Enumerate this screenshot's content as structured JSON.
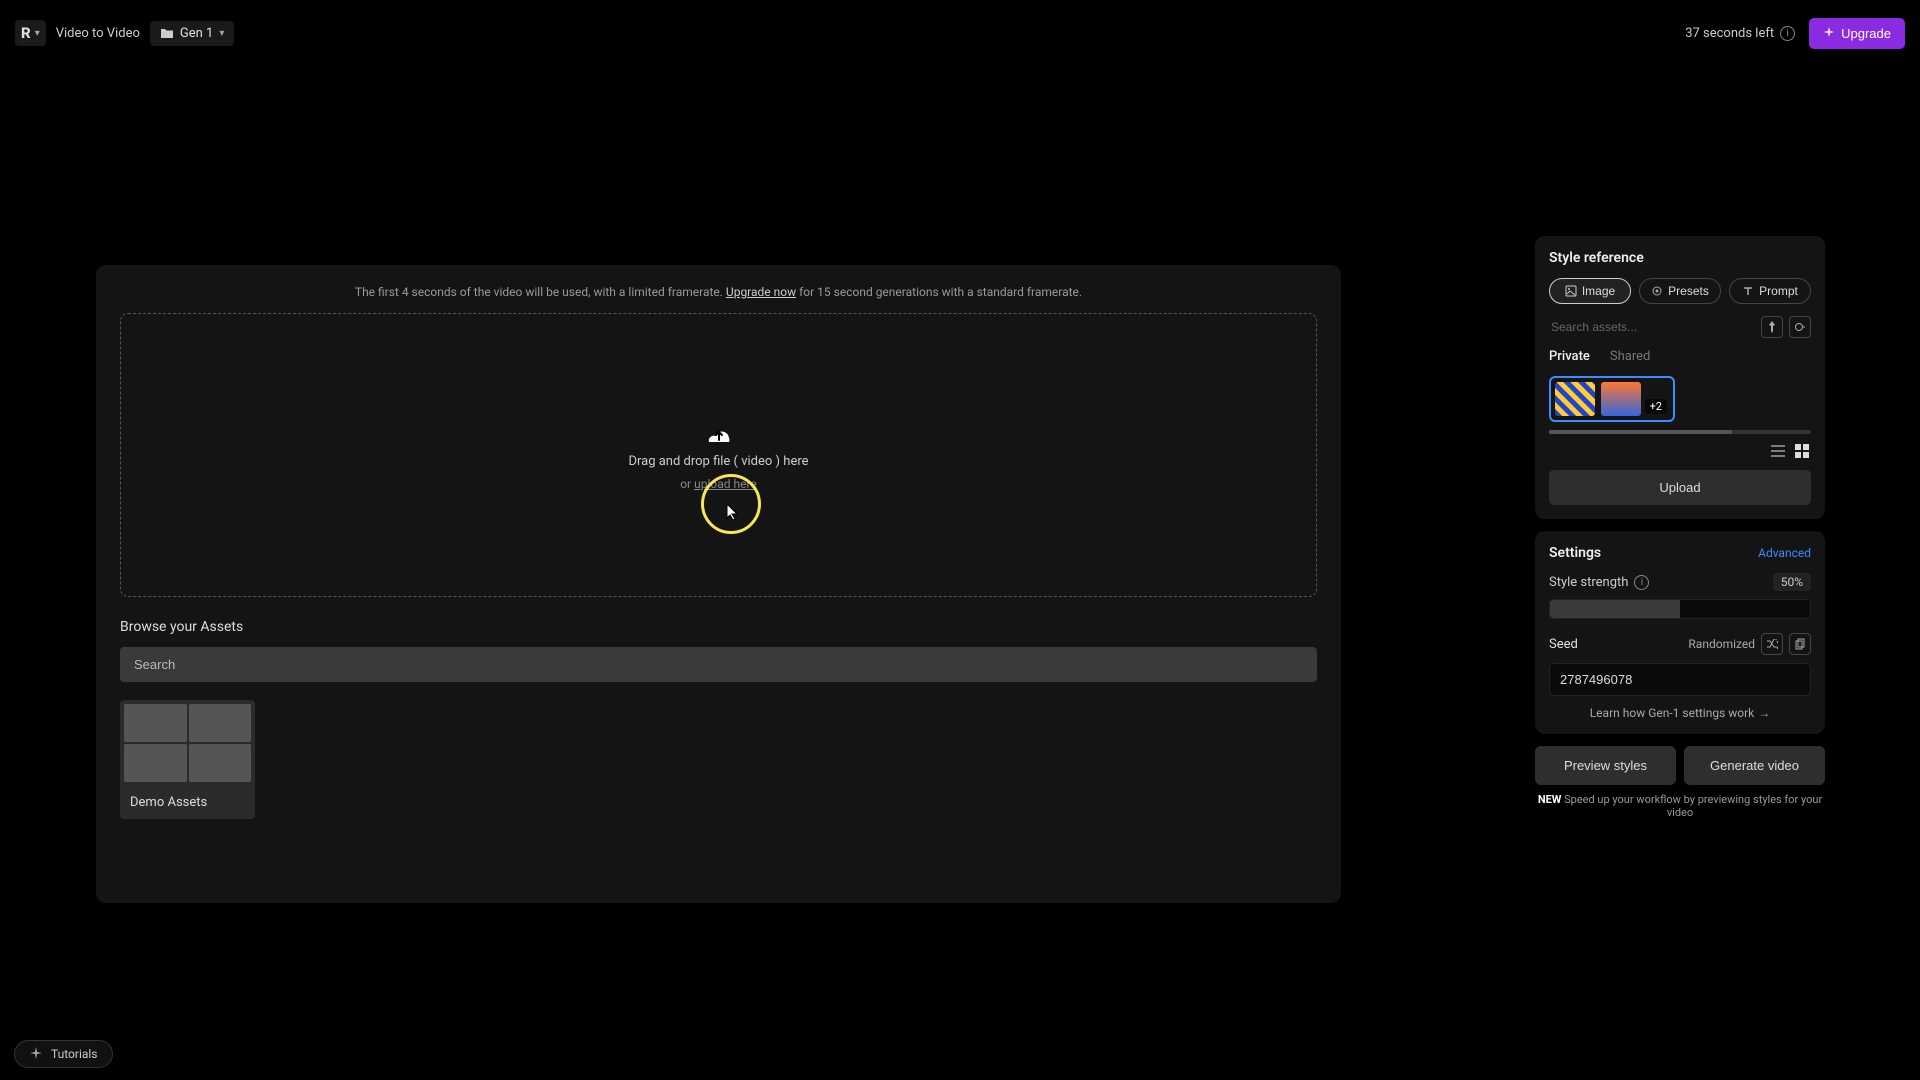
{
  "topbar": {
    "breadcrumb": "Video to Video",
    "folder": "Gen 1",
    "seconds_left": "37 seconds left",
    "upgrade": "Upgrade"
  },
  "main": {
    "hint_pre": "The first 4 seconds of the video will be used, with a limited framerate. ",
    "hint_link": "Upgrade now",
    "hint_post": " for 15 second generations with a standard framerate.",
    "drop_text": "Drag and drop file ( video ) here",
    "drop_sub_pre": "or ",
    "drop_sub_link": "upload here",
    "browse_title": "Browse your Assets",
    "search_placeholder": "Search",
    "asset_label": "Demo Assets"
  },
  "style": {
    "title": "Style reference",
    "pills": {
      "image": "Image",
      "presets": "Presets",
      "prompt": "Prompt"
    },
    "search_placeholder": "Search assets...",
    "tabs": {
      "private": "Private",
      "shared": "Shared"
    },
    "plus_badge": "+2",
    "upload": "Upload"
  },
  "settings": {
    "title": "Settings",
    "advanced": "Advanced",
    "strength_label": "Style strength",
    "strength_value": "50%",
    "seed_label": "Seed",
    "randomized": "Randomized",
    "seed_value": "2787496078",
    "learn": "Learn how Gen-1 settings work"
  },
  "actions": {
    "preview": "Preview styles",
    "generate": "Generate video",
    "new_tag": "NEW",
    "new_hint": " Speed up your workflow by previewing styles for your video"
  },
  "tutorials": "Tutorials"
}
